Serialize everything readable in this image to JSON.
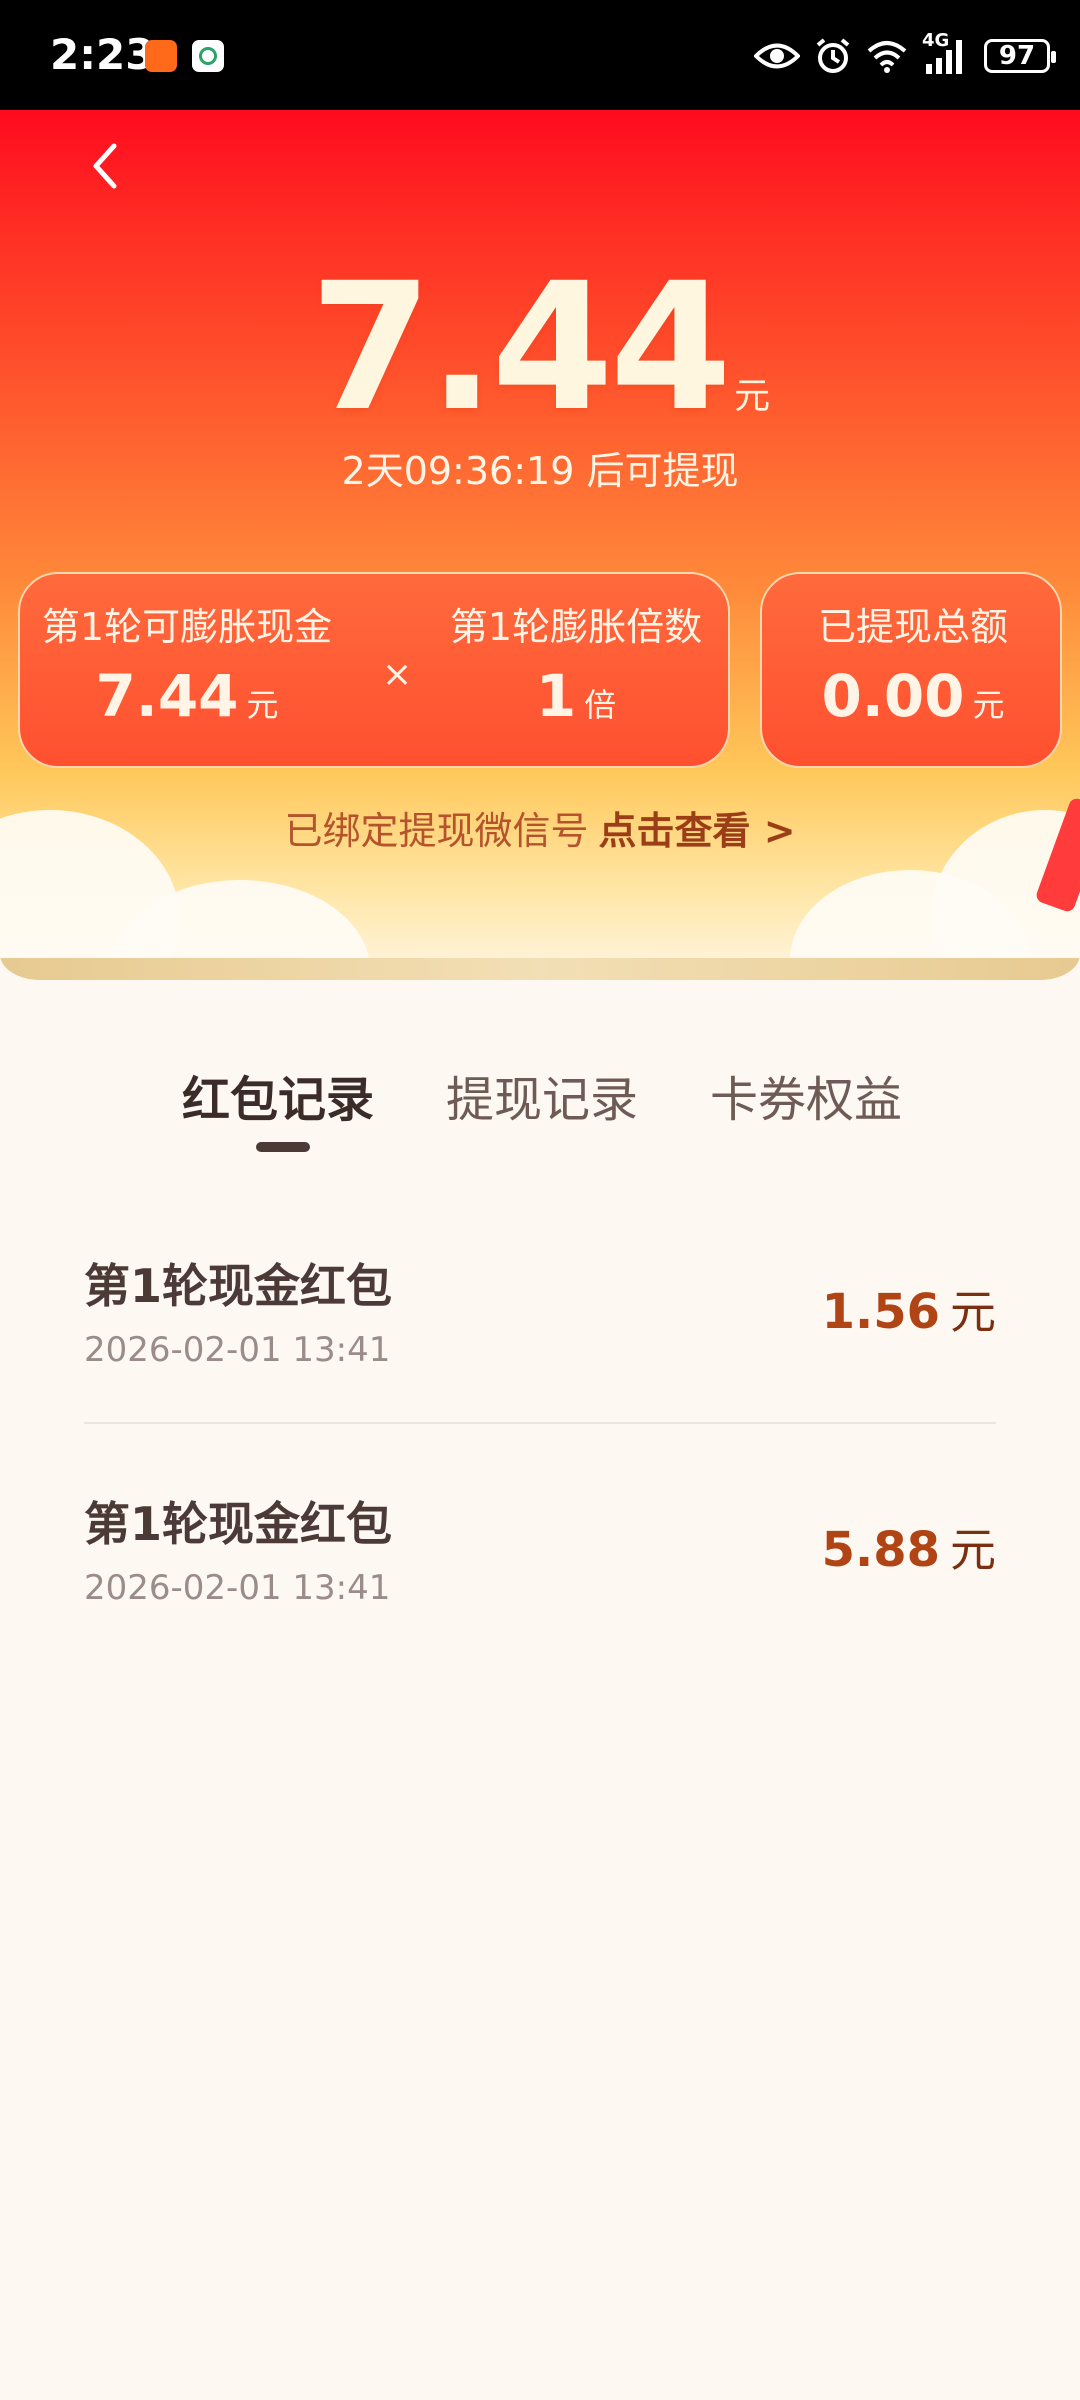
{
  "status_bar": {
    "time": "2:23",
    "battery": "97",
    "network": "4G"
  },
  "header": {
    "amount": "7.44",
    "amount_unit": "元",
    "countdown": "2天09:36:19 后可提现",
    "card_left": {
      "label1": "第1轮可膨胀现金",
      "value1": "7.44",
      "unit1": "元",
      "operator": "×",
      "label2": "第1轮膨胀倍数",
      "value2": "1",
      "unit2": "倍"
    },
    "card_right": {
      "label": "已提现总额",
      "value": "0.00",
      "unit": "元"
    },
    "wechat_text": "已绑定提现微信号",
    "wechat_link": "点击查看 >"
  },
  "tabs": [
    {
      "label": "红包记录"
    },
    {
      "label": "提现记录"
    },
    {
      "label": "卡券权益"
    }
  ],
  "records": [
    {
      "title": "第1轮现金红包",
      "date": "2026-02-01 13:41",
      "amount": "1.56",
      "unit": "元"
    },
    {
      "title": "第1轮现金红包",
      "date": "2026-02-01 13:41",
      "amount": "5.88",
      "unit": "元"
    }
  ],
  "colors": {
    "accent": "#ff2a23",
    "amount_text": "#b04414",
    "link": "#9b3e17"
  },
  "icons": [
    "back-icon",
    "eye-icon",
    "alarm-icon",
    "wifi-icon",
    "signal-icon",
    "battery-icon"
  ]
}
